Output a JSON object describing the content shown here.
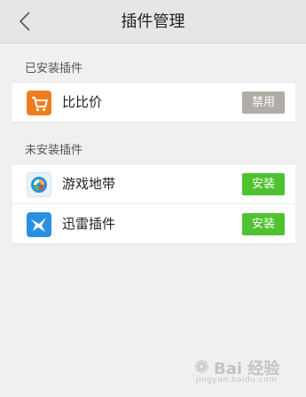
{
  "header": {
    "title": "插件管理",
    "back_icon": "back-chevron-icon"
  },
  "installed": {
    "label": "已安装插件",
    "items": [
      {
        "name": "比比价",
        "icon": "shopping-cart-icon",
        "icon_color": "#f27c1b",
        "button": "禁用",
        "button_color": "#b2aca6"
      }
    ]
  },
  "uninstalled": {
    "label": "未安装插件",
    "items": [
      {
        "name": "游戏地带",
        "icon": "game-zone-icon",
        "icon_color": "#2a8fe0",
        "button": "安装",
        "button_color": "#4ec230"
      },
      {
        "name": "迅雷插件",
        "icon": "thunder-bird-icon",
        "icon_color": "#2a8fe0",
        "button": "安装",
        "button_color": "#4ec230"
      }
    ]
  },
  "watermark": {
    "text": "Bai 经验",
    "sub": "jingyan.baidu.com"
  }
}
